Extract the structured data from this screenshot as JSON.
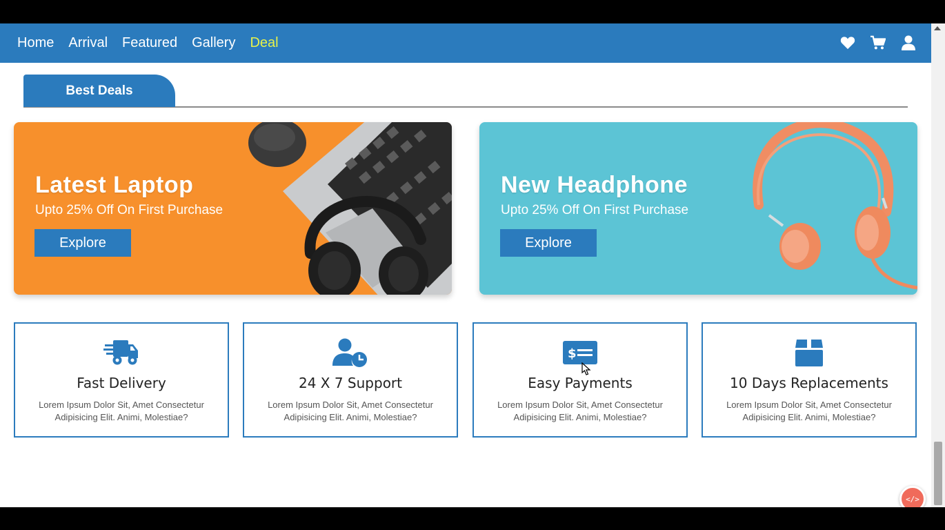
{
  "nav": {
    "links": [
      {
        "label": "Home",
        "active": false
      },
      {
        "label": "Arrival",
        "active": false
      },
      {
        "label": "Featured",
        "active": false
      },
      {
        "label": "Gallery",
        "active": false
      },
      {
        "label": "Deal",
        "active": true
      }
    ],
    "icons": [
      "heart-icon",
      "cart-icon",
      "user-icon"
    ]
  },
  "section": {
    "title": "Best Deals"
  },
  "banners": [
    {
      "title": "Latest Laptop",
      "subtitle": "Upto 25% Off On First Purchase",
      "button": "Explore",
      "color": "#f7902c"
    },
    {
      "title": "New Headphone",
      "subtitle": "Upto 25% Off On First Purchase",
      "button": "Explore",
      "color": "#5cc4d5"
    }
  ],
  "features": [
    {
      "icon": "truck-icon",
      "title": "Fast Delivery",
      "desc": "Lorem Ipsum Dolor Sit, Amet Consectetur Adipisicing Elit. Animi, Molestiae?"
    },
    {
      "icon": "user-clock-icon",
      "title": "24 X 7 Support",
      "desc": "Lorem Ipsum Dolor Sit, Amet Consectetur Adipisicing Elit. Animi, Molestiae?"
    },
    {
      "icon": "money-check-icon",
      "title": "Easy Payments",
      "desc": "Lorem Ipsum Dolor Sit, Amet Consectetur Adipisicing Elit. Animi, Molestiae?"
    },
    {
      "icon": "box-icon",
      "title": "10 Days Replacements",
      "desc": "Lorem Ipsum Dolor Sit, Amet Consectetur Adipisicing Elit. Animi, Molestiae?"
    }
  ],
  "badge": {
    "label": "</>"
  },
  "colors": {
    "primary": "#2b7bbd",
    "active_link": "#e7f24a",
    "laptop_bg": "#f7902c",
    "headphone_bg": "#5cc4d5"
  }
}
